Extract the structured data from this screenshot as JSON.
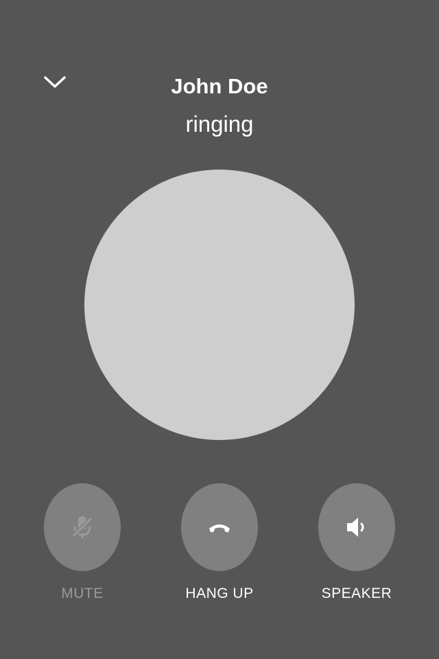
{
  "call": {
    "caller_name": "John Doe",
    "status": "ringing"
  },
  "header": {
    "collapse_icon": "chevron-down-icon"
  },
  "actions": [
    {
      "id": "mute",
      "label": "MUTE",
      "icon": "microphone-muted-icon",
      "enabled": false
    },
    {
      "id": "hangup",
      "label": "HANG UP",
      "icon": "phone-hangup-icon",
      "enabled": true
    },
    {
      "id": "speaker",
      "label": "SPEAKER",
      "icon": "speaker-icon",
      "enabled": true
    }
  ],
  "colors": {
    "background": "#555555",
    "avatar": "#cecece",
    "button": "#808080",
    "text": "#ffffff",
    "disabled_text": "#9a9a9a"
  }
}
